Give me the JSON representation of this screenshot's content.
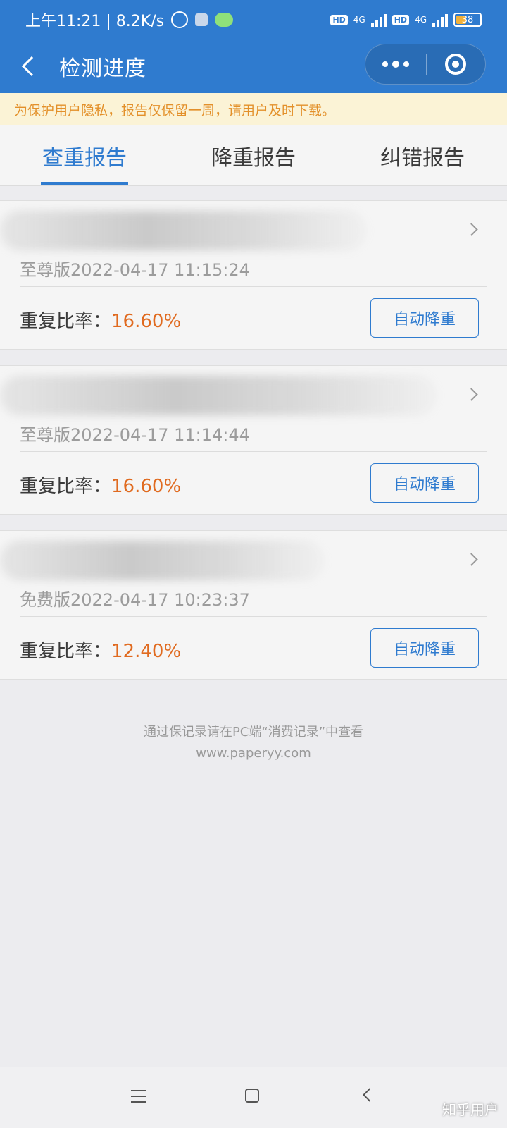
{
  "status_bar": {
    "time_speed": "上午11:21 | 8.2K/s",
    "hd_badge": "HD",
    "network": "4G",
    "battery": "38"
  },
  "header": {
    "title": "检测进度"
  },
  "notice": "为保护用户隐私，报告仅保留一周，请用户及时下载。",
  "tabs": [
    {
      "label": "查重报告",
      "active": true
    },
    {
      "label": "降重报告",
      "active": false
    },
    {
      "label": "纠错报告",
      "active": false
    }
  ],
  "reports": [
    {
      "meta": "至尊版2022-04-17 11:15:24",
      "rate_label": "重复比率：",
      "rate_value": "16.60%",
      "button": "自动降重"
    },
    {
      "meta": "至尊版2022-04-17 11:14:44",
      "rate_label": "重复比率：",
      "rate_value": "16.60%",
      "button": "自动降重"
    },
    {
      "meta": "免费版2022-04-17 10:23:37",
      "rate_label": "重复比率：",
      "rate_value": "12.40%",
      "button": "自动降重"
    }
  ],
  "footer": {
    "note": "通过保记录请在PC端“消费记录”中查看",
    "site": "www.paperyy.com"
  },
  "watermark": "知乎用户",
  "colors": {
    "brand_blue": "#2f7bcf",
    "rate_orange": "#e06a1f",
    "notice_text": "#e3902a",
    "notice_bg": "#fbf3d6"
  }
}
